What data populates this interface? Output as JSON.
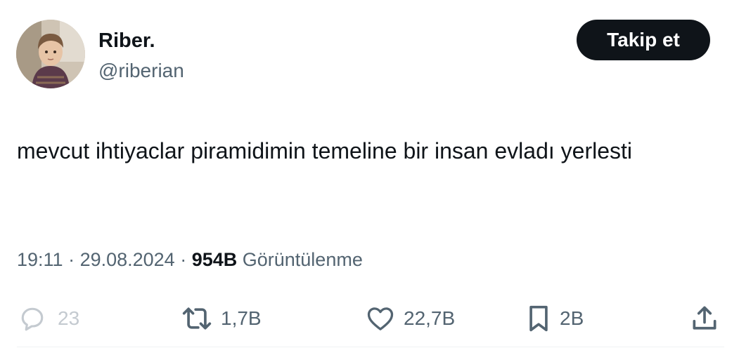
{
  "user": {
    "display_name": "Riber.",
    "handle": "@riberian"
  },
  "follow_button": {
    "label": "Takip et"
  },
  "tweet": {
    "text": "mevcut ihtiyaclar piramidimin temeline bir insan evladı yerlesti"
  },
  "meta": {
    "time": "19:11",
    "separator1": " · ",
    "date": "29.08.2024",
    "separator2": " · ",
    "views_count": "954B",
    "views_label": " Görüntülenme"
  },
  "actions": {
    "reply": {
      "icon": "reply-icon",
      "count": "23"
    },
    "retweet": {
      "icon": "retweet-icon",
      "count": "1,7B"
    },
    "like": {
      "icon": "heart-icon",
      "count": "22,7B"
    },
    "bookmark": {
      "icon": "bookmark-icon",
      "count": "2B"
    },
    "share": {
      "icon": "share-icon"
    }
  },
  "colors": {
    "text_primary": "#0f1419",
    "text_secondary": "#536471",
    "reply_faded": "#c4cad0",
    "follow_bg": "#0f1419",
    "follow_text": "#ffffff"
  }
}
